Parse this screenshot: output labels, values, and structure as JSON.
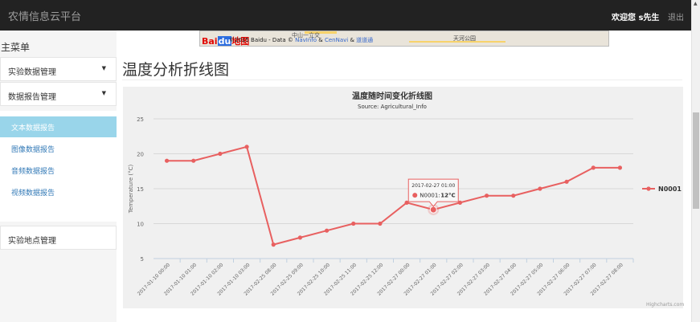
{
  "navbar": {
    "brand": "农情信息云平台",
    "welcome": "欢迎您 s先生",
    "logout": "退出"
  },
  "sidebar": {
    "title": "主菜单",
    "sections": [
      {
        "label": "实验数据管理",
        "caret": "▼"
      },
      {
        "label": "数据报告管理",
        "caret": "▼"
      }
    ],
    "subitems": [
      {
        "label": "文本数据报告",
        "active": true
      },
      {
        "label": "图像数据报告",
        "active": false
      },
      {
        "label": "音频数据报告",
        "active": false
      },
      {
        "label": "视频数据报告",
        "active": false
      }
    ],
    "bottom_item": "实验地点管理"
  },
  "map": {
    "logo_left": "Bai",
    "logo_mid": "du",
    "logo_right": "地图",
    "copyright": "©2015 Baidu - Data ©",
    "navinfo": "NavInfo",
    "amp1": "&",
    "cennavi": "CenNavi",
    "amp2": "&",
    "daotong": "道道通",
    "park": "天河公园",
    "street": "中山一立交"
  },
  "page": {
    "title": "温度分析折线图"
  },
  "chart_data": {
    "type": "line",
    "title": "温度随时间变化折线图",
    "subtitle": "Source: Agricultural_Info",
    "xlabel": "",
    "ylabel": "Temperature (°C)",
    "ylim": [
      5,
      25
    ],
    "yticks": [
      5,
      10,
      15,
      20,
      25
    ],
    "grid": true,
    "legend_position": "right",
    "categories": [
      "2017-01-10 00:00",
      "2017-01-10 01:00",
      "2017-01-10 02:00",
      "2017-01-10 03:00",
      "2017-02-25 08:00",
      "2017-02-25 09:00",
      "2017-02-25 10:00",
      "2017-02-25 11:00",
      "2017-02-25 12:00",
      "2017-02-27 00:00",
      "2017-02-27 01:00",
      "2017-02-27 02:00",
      "2017-02-27 03:00",
      "2017-02-27 04:00",
      "2017-02-27 05:00",
      "2017-02-27 06:00",
      "2017-02-27 07:00",
      "2017-02-27 08:00"
    ],
    "series": [
      {
        "name": "N0001",
        "values": [
          19,
          19,
          20,
          21,
          7,
          8,
          9,
          10,
          10,
          13,
          12,
          13,
          14,
          14,
          15,
          16,
          18,
          18
        ]
      }
    ],
    "tooltip": {
      "index": 10,
      "header": "2017-02-27 01:00",
      "series": "N0001:",
      "value": "12°C"
    },
    "credits": "Highcharts.com",
    "color": "#e86060"
  }
}
